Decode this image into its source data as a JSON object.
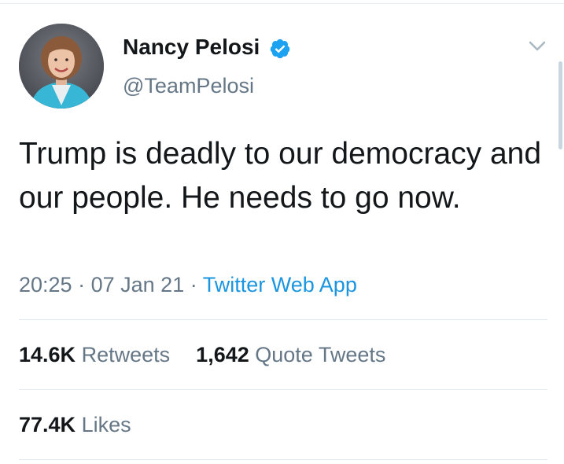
{
  "author": {
    "name": "Nancy Pelosi",
    "handle": "@TeamPelosi",
    "verified": true
  },
  "tweet": {
    "text": "Trump is deadly to our democracy and our people. He needs to go now.",
    "time": "20:25",
    "separator": "·",
    "date": "07 Jan 21",
    "source": "Twitter Web App"
  },
  "stats": {
    "retweets_count": "14.6K",
    "retweets_label": "Retweets",
    "quotes_count": "1,642",
    "quotes_label": "Quote Tweets",
    "likes_count": "77.4K",
    "likes_label": "Likes"
  },
  "colors": {
    "text": "#14171a",
    "secondary": "#657786",
    "link": "#1b95e0",
    "verified": "#1da1f2",
    "divider": "#e1e8ed"
  }
}
